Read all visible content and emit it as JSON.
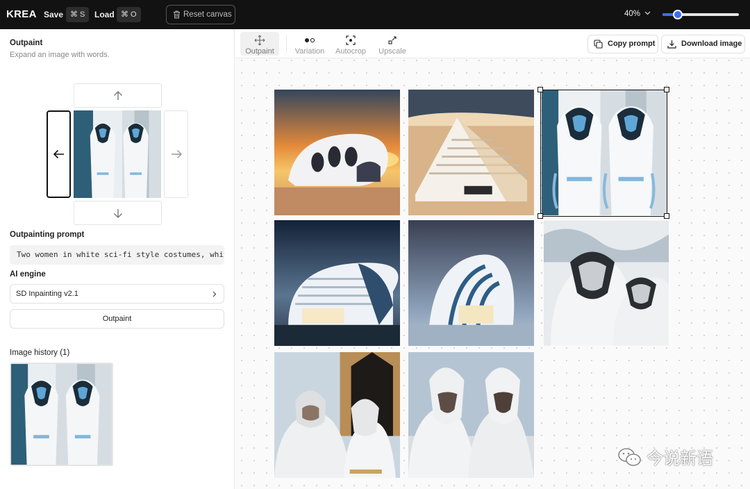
{
  "topbar": {
    "logo": "KREA",
    "save_label": "Save",
    "save_shortcut": "⌘ S",
    "load_label": "Load",
    "load_shortcut": "⌘ O",
    "reset_label": "Reset canvas",
    "zoom_label": "40%",
    "zoom_value": 0.2
  },
  "panel": {
    "title": "Outpaint",
    "subtitle": "Expand an image with words.",
    "prompt_label": "Outpainting prompt",
    "prompt_value": "Two women in white sci-fi style costumes, white",
    "engine_label": "AI engine",
    "engine_value": "SD Inpainting v2.1",
    "outpaint_button": "Outpaint",
    "history_label": "Image history (1)"
  },
  "toolbar": {
    "tools": [
      {
        "label": "Outpaint",
        "icon": "move-arrows-icon"
      },
      {
        "label": "Variation",
        "icon": "dots-icon"
      },
      {
        "label": "Autocrop",
        "icon": "crop-focus-icon"
      },
      {
        "label": "Upscale",
        "icon": "expand-icon"
      }
    ],
    "copy_prompt": "Copy prompt",
    "download_image": "Download image"
  },
  "canvas": {
    "images": [
      {
        "subject": "futuristic white building at sunset"
      },
      {
        "subject": "layered white structure in desert"
      },
      {
        "subject": "two women in white sci-fi costumes",
        "selected": true
      },
      {
        "subject": "curved white building at night"
      },
      {
        "subject": "white shell-shaped building under stars"
      },
      {
        "subject": "masked figures in white"
      },
      {
        "subject": "women in white helmets with arch"
      },
      {
        "subject": "two masked women in white hoods"
      }
    ]
  },
  "watermark": "今说新语",
  "colors": {
    "accent": "#3b6cf6",
    "topbar_bg": "#121212"
  }
}
